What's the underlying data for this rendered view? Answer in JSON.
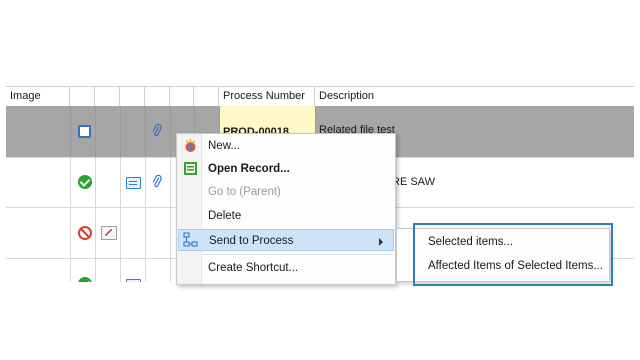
{
  "grid": {
    "columns": [
      {
        "label": "Image"
      },
      {
        "label": ""
      },
      {
        "label": ""
      },
      {
        "label": ""
      },
      {
        "label": ""
      },
      {
        "label": ""
      },
      {
        "label": ""
      },
      {
        "label": "Process Number"
      },
      {
        "label": "Description"
      }
    ],
    "rows": [
      {
        "process_number": "PROD-00018",
        "description": "Related file test",
        "state_icon": "square-icon",
        "selected": true
      },
      {
        "process_number": "",
        "description": "RE SAW",
        "state_icon": "check-circle-icon",
        "selected": false
      },
      {
        "process_number": "",
        "description": "",
        "state_icon": "no-entry-icon",
        "selected": false
      },
      {
        "process_number": "",
        "description": "",
        "state_icon": "check-circle-icon",
        "selected": false
      }
    ]
  },
  "context_menu": {
    "items": [
      {
        "label": "New...",
        "icon": "new-icon",
        "bold": false,
        "disabled": false
      },
      {
        "label": "Open Record...",
        "icon": "open-record-icon",
        "bold": true,
        "disabled": false
      },
      {
        "label": "Go to (Parent)",
        "icon": "",
        "bold": false,
        "disabled": true
      },
      {
        "label": "Delete",
        "icon": "",
        "bold": false,
        "disabled": false
      },
      {
        "label": "Send to Process",
        "icon": "send-to-process-icon",
        "bold": false,
        "disabled": false,
        "highlighted": true,
        "submenu": true
      },
      {
        "label": "Create Shortcut...",
        "icon": "",
        "bold": false,
        "disabled": false
      }
    ]
  },
  "submenu": {
    "items": [
      {
        "label": "Selected items..."
      },
      {
        "label": "Affected Items of Selected Items..."
      }
    ]
  },
  "colors": {
    "selected_row": "#a6a6a6",
    "process_cell": "#fff9c9",
    "menu_highlight": "#cde4f8",
    "callout_border": "#2a7fb3"
  }
}
